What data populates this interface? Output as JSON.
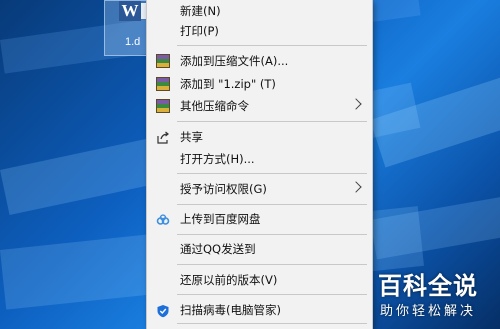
{
  "desktop": {
    "file_name": "1.d",
    "file_icon_letter": "W"
  },
  "menu": {
    "items": [
      {
        "label": "新建(N)"
      },
      {
        "label": "打印(P)"
      },
      {
        "label": "添加到压缩文件(A)..."
      },
      {
        "label": "添加到 \"1.zip\" (T)"
      },
      {
        "label": "其他压缩命令"
      },
      {
        "label": "共享"
      },
      {
        "label": "打开方式(H)..."
      },
      {
        "label": "授予访问权限(G)"
      },
      {
        "label": "上传到百度网盘"
      },
      {
        "label": "通过QQ发送到"
      },
      {
        "label": "还原以前的版本(V)"
      },
      {
        "label": "扫描病毒(电脑管家)"
      }
    ]
  },
  "watermark": {
    "title": "百科全说",
    "subtitle": "助你轻松解决"
  },
  "colors": {
    "menu_bg": "#f2f2f2",
    "desktop_blue": "#0d5fbf",
    "separator": "#c8c8c8"
  }
}
